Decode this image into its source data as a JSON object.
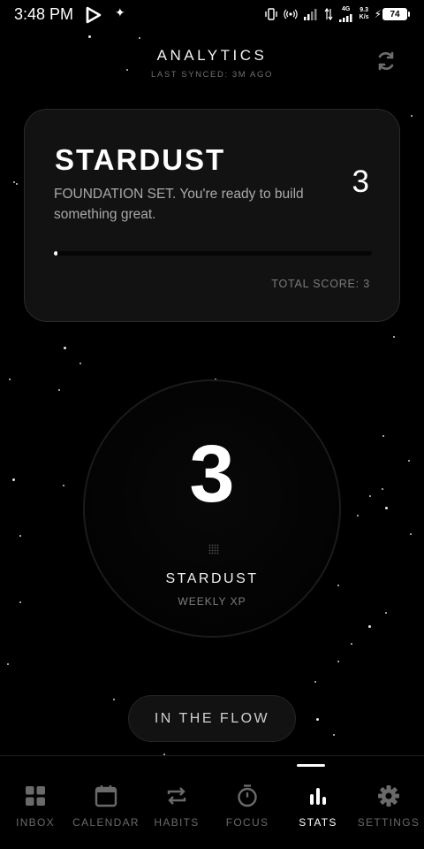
{
  "status_bar": {
    "time": "3:48 PM",
    "network": "4G",
    "speed": "9.3",
    "speed_unit": "K/s",
    "battery": "74"
  },
  "header": {
    "title": "ANALYTICS",
    "subtitle": "LAST SYNCED: 3M AGO"
  },
  "card": {
    "title": "STARDUST",
    "description": "FOUNDATION SET. You're ready to build something great.",
    "value": "3",
    "progress": 0.01,
    "total_label": "TOTAL SCORE: 3"
  },
  "ring": {
    "value": "3",
    "label": "STARDUST",
    "sublabel": "WEEKLY XP"
  },
  "flow_button": {
    "label": "IN THE FLOW"
  },
  "nav": {
    "items": [
      {
        "label": "INBOX",
        "icon": "grid-icon",
        "active": false
      },
      {
        "label": "CALENDAR",
        "icon": "calendar-icon",
        "active": false
      },
      {
        "label": "HABITS",
        "icon": "repeat-icon",
        "active": false
      },
      {
        "label": "FOCUS",
        "icon": "stopwatch-icon",
        "active": false
      },
      {
        "label": "STATS",
        "icon": "bar-chart-icon",
        "active": true
      },
      {
        "label": "SETTINGS",
        "icon": "gear-icon",
        "active": false
      }
    ]
  },
  "colors": {
    "background": "#000000",
    "card": "#121212",
    "text_muted": "#7a7a7a",
    "accent": "#ffffff"
  }
}
